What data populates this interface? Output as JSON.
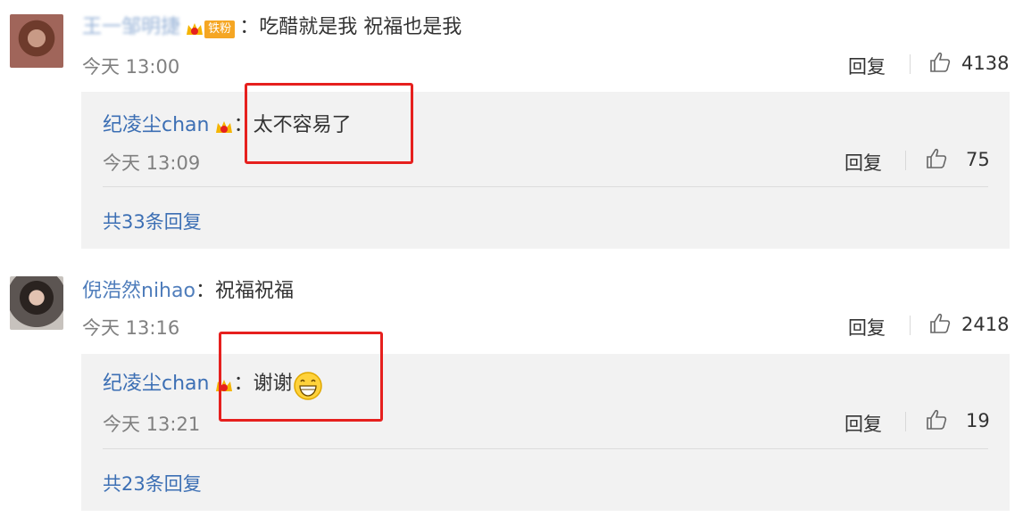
{
  "comments": [
    {
      "username": "王一邹明捷",
      "badge": "铁粉",
      "separator": "：",
      "text": "吃醋就是我 祝福也是我",
      "time": "今天 13:00",
      "reply_label": "回复",
      "likes": "4138",
      "reply": {
        "username": "纪凌尘chan",
        "separator": "：",
        "text": "太不容易了",
        "time": "今天 13:09",
        "reply_label": "回复",
        "likes": "75"
      },
      "more_replies": "共33条回复"
    },
    {
      "username": "倪浩然nihao",
      "separator": "：",
      "text": "祝福祝福",
      "time": "今天 13:16",
      "reply_label": "回复",
      "likes": "2418",
      "reply": {
        "username": "纪凌尘chan",
        "separator": "：",
        "text": "谢谢",
        "time": "今天 13:21",
        "reply_label": "回复",
        "likes": "19"
      },
      "more_replies": "共23条回复"
    }
  ],
  "colors": {
    "link": "#3c6fb4",
    "highlight": "#e6201e",
    "reply_bg": "#f2f2f2"
  },
  "icons": [
    "crown-icon",
    "thumbs-up-icon",
    "grin-emoji-icon"
  ]
}
